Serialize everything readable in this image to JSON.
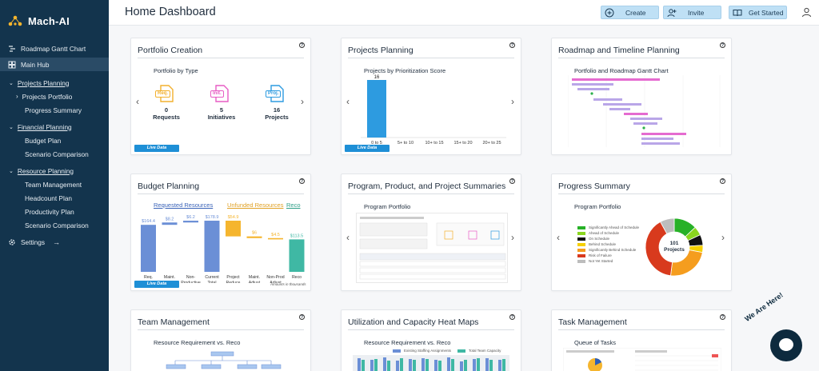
{
  "app": {
    "name": "Mach-AI"
  },
  "sidebar": {
    "items": [
      {
        "label": "Roadmap Gantt Chart"
      },
      {
        "label": "Main Hub"
      }
    ],
    "sections": [
      {
        "label": "Projects Planning",
        "children": [
          "Projects Portfolio",
          "Progress Summary"
        ]
      },
      {
        "label": "Financial Planning",
        "children": [
          "Budget Plan",
          "Scenario Comparison"
        ]
      },
      {
        "label": "Resource Planning",
        "children": [
          "Team Management",
          "Headcount Plan",
          "Productivity Plan",
          "Scenario Comparison"
        ]
      }
    ],
    "settings": "Settings"
  },
  "header": {
    "title": "Home Dashboard",
    "create": "Create",
    "invite": "Invite",
    "get_started": "Get Started"
  },
  "cards": {
    "portfolio": {
      "title": "Portfolio Creation",
      "subtitle": "Portfolio by Type",
      "types": [
        {
          "code": "Req.",
          "count": "0",
          "label": "Requests",
          "color": "#f2b02e"
        },
        {
          "code": "Init.",
          "count": "5",
          "label": "Initiatives",
          "color": "#e75cc4"
        },
        {
          "code": "Proj.",
          "count": "16",
          "label": "Projects",
          "color": "#2d9be0"
        }
      ],
      "live": "Live Data"
    },
    "projects": {
      "title": "Projects Planning",
      "subtitle": "Projects by Prioritization Score",
      "live": "Live Data"
    },
    "roadmap": {
      "title": "Roadmap and Timeline Planning",
      "subtitle": "Portfolio and Roadmap Gantt Chart"
    },
    "budget": {
      "title": "Budget Planning",
      "group_requested": "Requested Resources",
      "group_unfunded": "Unfunded Resources",
      "group_reco": "Reco",
      "note": "Amounts in thousands",
      "live": "Live Data"
    },
    "program": {
      "title": "Program, Product, and Project Summaries",
      "subtitle": "Program Portfolio"
    },
    "progress": {
      "title": "Progress Summary",
      "subtitle": "Program Portfolio",
      "center_count": "101",
      "center_label": "Projects",
      "legend": [
        "Significantly Ahead of Schedule",
        "Ahead of Schedule",
        "On Schedule",
        "Behind Schedule",
        "Significantly Behind Schedule",
        "Risk of Failure",
        "Not Yet Started"
      ]
    },
    "team": {
      "title": "Team Management",
      "subtitle": "Resource Requirement vs. Reco"
    },
    "utilization": {
      "title": "Utilization and Capacity Heat Maps",
      "subtitle": "Resource Requirement vs. Reco",
      "legend": [
        "Existing Staffing Assignments",
        "Total Team Capacity"
      ]
    },
    "task": {
      "title": "Task Management",
      "subtitle": "Queue of Tasks"
    }
  },
  "chart_data": [
    {
      "type": "bar",
      "title": "Projects by Prioritization Score",
      "categories": [
        "0 to 5",
        "5+ to 10",
        "10+ to 15",
        "15+ to 20",
        "20+ to 25"
      ],
      "values": [
        16,
        0,
        0,
        0,
        0
      ],
      "color": "#2d9be0"
    },
    {
      "type": "bar",
      "categories": [
        "Req. Projects",
        "Maint.",
        "Non-Productive",
        "Current Total",
        "Project Reduce",
        "Maint. Adjust",
        "Non-Prod Adjust",
        "Reco"
      ],
      "values": [
        164.4,
        8.2,
        6.2,
        178.9,
        54.9,
        6,
        4.5,
        113.5
      ],
      "labels": [
        "$164.4",
        "$8.2",
        "$6.2",
        "$178.9",
        "$54.9",
        "$6",
        "$4.5",
        "$113.5"
      ],
      "colors": [
        "#6b8fd6",
        "#6b8fd6",
        "#6b8fd6",
        "#6b8fd6",
        "#f5b52e",
        "#f5b52e",
        "#f5b52e",
        "#3fb8a4"
      ]
    },
    {
      "type": "pie",
      "title": "Program Portfolio",
      "labels": [
        "Significantly Ahead of Schedule",
        "Ahead of Schedule",
        "On Schedule",
        "Behind Schedule",
        "Significantly Behind Schedule",
        "Risk of Failure",
        "Not Yet Started"
      ],
      "values": [
        13,
        5,
        6,
        4,
        24,
        40,
        8
      ],
      "colors": [
        "#27b127",
        "#8ad61f",
        "#111111",
        "#f5d000",
        "#f59d1e",
        "#d83a1d",
        "#bdbdbd"
      ]
    }
  ]
}
